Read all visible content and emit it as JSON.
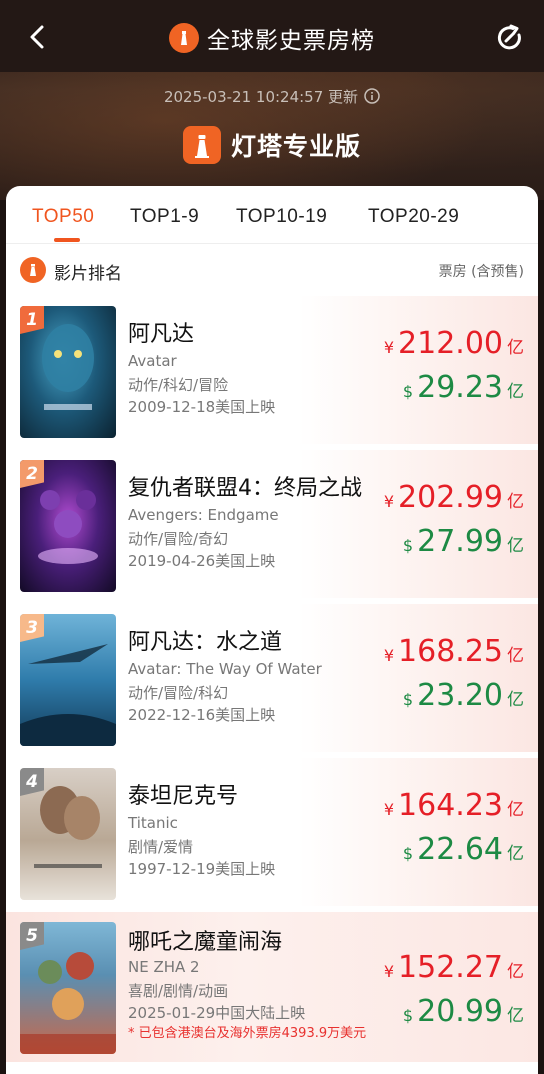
{
  "header": {
    "title": "全球影史票房榜",
    "update_time": "2025-03-21 10:24:57 更新",
    "brand": "灯塔专业版"
  },
  "tabs": [
    "TOP50",
    "TOP1-9",
    "TOP10-19",
    "TOP20-29"
  ],
  "list_header": {
    "title": "影片排名",
    "right": "票房 (含预售)"
  },
  "movies": [
    {
      "rank": "1",
      "title": "阿凡达",
      "en": "Avatar",
      "genre": "动作/科幻/冒险",
      "date": "2009-12-18美国上映",
      "cny_symbol": "¥",
      "cny": "212.00",
      "cny_unit": "亿",
      "usd_symbol": "$",
      "usd": "29.23",
      "usd_unit": "亿",
      "rank_color": "#f06b3c"
    },
    {
      "rank": "2",
      "title": "复仇者联盟4：终局之战",
      "en": "Avengers: Endgame",
      "genre": "动作/冒险/奇幻",
      "date": "2019-04-26美国上映",
      "cny_symbol": "¥",
      "cny": "202.99",
      "cny_unit": "亿",
      "usd_symbol": "$",
      "usd": "27.99",
      "usd_unit": "亿",
      "rank_color": "#f39a6a"
    },
    {
      "rank": "3",
      "title": "阿凡达：水之道",
      "en": "Avatar: The Way Of Water",
      "genre": "动作/冒险/科幻",
      "date": "2022-12-16美国上映",
      "cny_symbol": "¥",
      "cny": "168.25",
      "cny_unit": "亿",
      "usd_symbol": "$",
      "usd": "23.20",
      "usd_unit": "亿",
      "rank_color": "#f7b98a"
    },
    {
      "rank": "4",
      "title": "泰坦尼克号",
      "en": "Titanic",
      "genre": "剧情/爱情",
      "date": "1997-12-19美国上映",
      "cny_symbol": "¥",
      "cny": "164.23",
      "cny_unit": "亿",
      "usd_symbol": "$",
      "usd": "22.64",
      "usd_unit": "亿",
      "rank_color": "#8a8a8a"
    },
    {
      "rank": "5",
      "title": "哪吒之魔童闹海",
      "en": "NE ZHA 2",
      "genre": "喜剧/剧情/动画",
      "date": "2025-01-29中国大陆上映",
      "note": "* 已包含港澳台及海外票房4393.9万美元",
      "cny_symbol": "¥",
      "cny": "152.27",
      "cny_unit": "亿",
      "usd_symbol": "$",
      "usd": "20.99",
      "usd_unit": "亿",
      "rank_color": "#8a8a8a"
    }
  ],
  "colors": {
    "accent": "#f0551f",
    "cny": "#e51f27",
    "usd": "#1d8a44"
  }
}
